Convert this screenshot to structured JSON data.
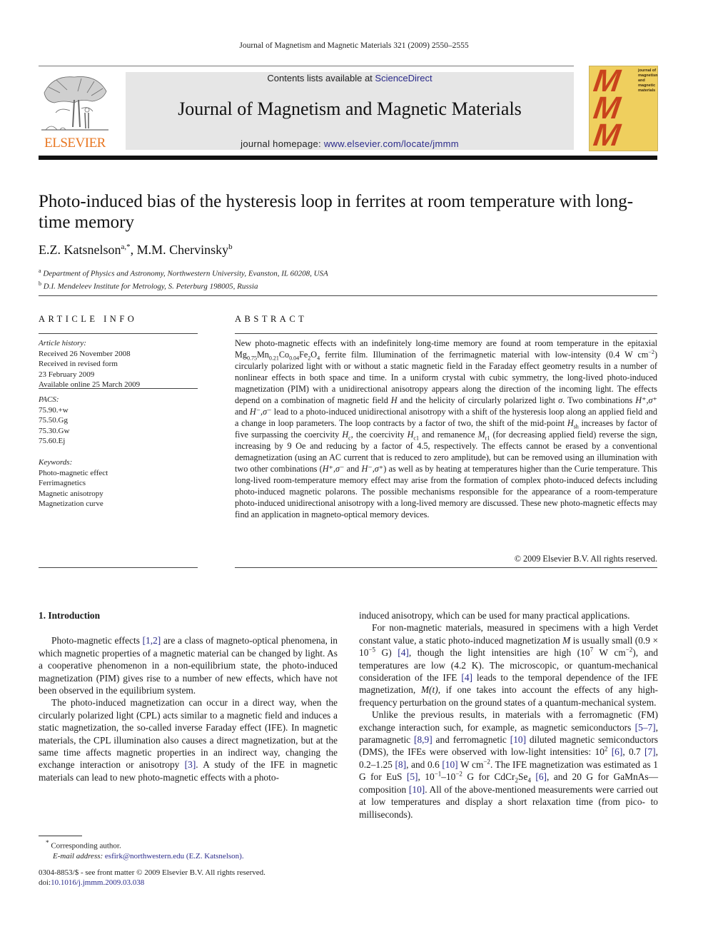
{
  "running_head": "Journal of Magnetism and Magnetic Materials 321 (2009) 2550–2555",
  "masthead": {
    "publisher_logo_text": "ELSEVIER",
    "contents_prefix": "Contents lists available at ",
    "contents_link": "ScienceDirect",
    "journal_name": "Journal of Magnetism and Magnetic Materials",
    "homepage_prefix": "journal homepage: ",
    "homepage_link": "www.elsevier.com/locate/jmmm",
    "cover_letters": [
      "M",
      "M",
      "M"
    ],
    "cover_text": [
      "journal of",
      "magnetism",
      "and",
      "magnetic",
      "materials"
    ],
    "colors": {
      "elsevier_orange": "#e87722",
      "cover_bg": "#efcf5e",
      "cover_m": "#c9431c",
      "link": "#2a2a8a",
      "banner_bg": "#e6e6e6"
    }
  },
  "article": {
    "title": "Photo-induced bias of the hysteresis loop in ferrites at room temperature with long-time memory",
    "authors": [
      {
        "name": "E.Z. Katsnelson",
        "marks": "a,*"
      },
      {
        "name": "M.M. Chervinsky",
        "marks": "b"
      }
    ],
    "author_separator": ", ",
    "affiliations": [
      {
        "mark": "a",
        "text": "Department of Physics and Astronomy, Northwestern University, Evanston, IL 60208, USA"
      },
      {
        "mark": "b",
        "text": "D.I. Mendeleev Institute for Metrology, S. Peterburg 198005, Russia"
      }
    ]
  },
  "article_info": {
    "heading": "ARTICLE INFO",
    "history_label": "Article history:",
    "history": [
      "Received 26 November 2008",
      "Received in revised form",
      "23 February 2009",
      "Available online 25 March 2009"
    ],
    "pacs_label": "PACS:",
    "pacs": [
      "75.90.+w",
      "75.50.Gg",
      "75.30.Gw",
      "75.60.Ej"
    ],
    "keywords_label": "Keywords:",
    "keywords": [
      "Photo-magnetic effect",
      "Ferrimagnetics",
      "Magnetic anisotropy",
      "Magnetization curve"
    ]
  },
  "abstract": {
    "heading": "ABSTRACT",
    "t1": "New photo-magnetic effects with an indefinitely long-time memory are found at room temperature in the epitaxial Mg",
    "s1": "0.75",
    "t2": "Mn",
    "s2": "0.21",
    "t3": "Co",
    "s3": "0.04",
    "t4": "Fe",
    "s4": "2",
    "t5": "O",
    "s5": "4",
    "t6": " ferrite film. Illumination of the ferrimagnetic material with low-intensity (0.4 W cm",
    "p1": "−2",
    "t7": ") circularly polarized light with or without a static magnetic field in the Faraday effect geometry results in a number of nonlinear effects in both space and time. In a uniform crystal with cubic symmetry, the long-lived photo-induced magnetization (PIM) with a unidirectional anisotropy appears along the direction of the incoming light. The effects depend on a combination of magnetic field ",
    "H": "H",
    "t8": " and the helicity of circularly polarized light ",
    "sigma": "σ",
    "t9": ". Two combinations ",
    "combo1": "H⁺,σ⁺",
    "t10": " and ",
    "combo2": "H⁻,σ⁻",
    "t11": " lead to a photo-induced unidirectional anisotropy with a shift of the hysteresis loop along an applied field and a change in loop parameters. The loop contracts by a factor of two, the shift of the mid-point ",
    "Hsh": "H",
    "Hsh_sub": "sh",
    "t12": " increases by factor of five surpassing the coercivity ",
    "Hc": "H",
    "Hc_sub": "c",
    "t13": ", the coercivity ",
    "Hc1": "H",
    "Hc1_sub": "c1",
    "t14": " and remanence ",
    "Mr1": "M",
    "Mr1_sub": "r1",
    "t15": " (for decreasing applied field) reverse the sign, increasing by 9 Oe and reducing by a factor of 4.5, respectively. The effects cannot be erased by a conventional demagnetization (using an AC current that is reduced to zero amplitude), but can be removed using an illumination with two other combinations (",
    "combo3": "H⁺,σ⁻",
    "t16": " and ",
    "combo4": "H⁻,σ⁺",
    "t17": ") as well as by heating at temperatures higher than the Curie temperature. This long-lived room-temperature memory effect may arise from the formation of complex photo-induced defects including photo-induced magnetic polarons. The possible mechanisms responsible for the appearance of a room-temperature photo-induced unidirectional anisotropy with a long-lived memory are discussed. These new photo-magnetic effects may find an application in magneto-optical memory devices.",
    "copyright": "© 2009 Elsevier B.V. All rights reserved."
  },
  "body": {
    "section_heading": "1.  Introduction",
    "left": {
      "p1a": "Photo-magnetic effects ",
      "p1_ref": "[1,2]",
      "p1b": " are a class of magneto-optical phenomena, in which magnetic properties of a magnetic material can be changed by light. As a cooperative phenomenon in a non-equilibrium state, the photo-induced magnetization (PIM) gives rise to a number of new effects, which have not been observed in the equilibrium system.",
      "p2a": "The photo-induced magnetization can occur in a direct way, when the circularly polarized light (CPL) acts similar to a magnetic field and induces a static magnetization, the so-called inverse Faraday effect (IFE). In magnetic materials, the CPL illumination also causes a direct magnetization, but at the same time affects magnetic properties in an indirect way, changing the exchange interaction or anisotropy ",
      "p2_ref": "[3]",
      "p2b": ". A study of the IFE in magnetic materials can lead to new photo-magnetic effects with a photo-"
    },
    "right": {
      "p0": "induced anisotropy, which can be used for many practical applications.",
      "p3a": "For non-magnetic materials, measured in specimens with a high Verdet constant value, a static photo-induced magnetization ",
      "p3_M": "M",
      "p3b": " is usually small (0.9 × 10",
      "p3_exp1": "−5",
      "p3c": " G) ",
      "p3_ref1": "[4]",
      "p3d": ", though the light intensities are high (10",
      "p3_exp2": "7",
      "p3e": " W cm",
      "p3_exp3": "−2",
      "p3f": "), and temperatures are low (4.2 K). The microscopic, or quantum-mechanical consideration of the IFE ",
      "p3_ref2": "[4]",
      "p3g": " leads to the temporal dependence of the IFE magnetization, ",
      "p3_Mt": "M(t)",
      "p3h": ", if one takes into account the effects of any high-frequency perturbation on the ground states of a quantum-mechanical system.",
      "p4a": "Unlike the previous results, in materials with a ferromagnetic (FM) exchange interaction such, for example, as magnetic semiconductors ",
      "p4_ref1": "[5–7]",
      "p4b": ", paramagnetic ",
      "p4_ref2": "[8,9]",
      "p4c": " and ferromagnetic ",
      "p4_ref3": "[10]",
      "p4d": " diluted magnetic semiconductors (DMS), the IFEs were observed with low-light intensities: 10",
      "p4_exp1": "2",
      "p4e": " ",
      "p4_ref4": "[6]",
      "p4f": ", 0.7 ",
      "p4_ref5": "[7]",
      "p4g": ", 0.2–1.25 ",
      "p4_ref6": "[8]",
      "p4h": ", and 0.6 ",
      "p4_ref7": "[10]",
      "p4i": " W cm",
      "p4_exp2": "−2",
      "p4j": ". The IFE magnetization was estimated as 1 G for EuS ",
      "p4_ref8": "[5]",
      "p4k": ", 10",
      "p4_exp3": "−1",
      "p4l": "–10",
      "p4_exp4": "−2",
      "p4m": " G for CdCr",
      "p4_sub1": "2",
      "p4n": "Se",
      "p4_sub2": "4",
      "p4o": " ",
      "p4_ref9": "[6]",
      "p4p": ", and 20 G for GaMnAs—composition ",
      "p4_ref10": "[10]",
      "p4q": ". All of the above-mentioned measurements were carried out at low temperatures and display a short relaxation time (from pico- to milliseconds)."
    }
  },
  "footnotes": {
    "corresponding_mark": "*",
    "corresponding_text": " Corresponding author.",
    "email_label": "E-mail address: ",
    "email": "esfirk@northwestern.edu",
    "email_owner": " (E.Z. Katsnelson).",
    "front_matter": "0304-8853/$ - see front matter © 2009 Elsevier B.V. All rights reserved.",
    "doi_label": "doi:",
    "doi": "10.1016/j.jmmm.2009.03.038"
  }
}
